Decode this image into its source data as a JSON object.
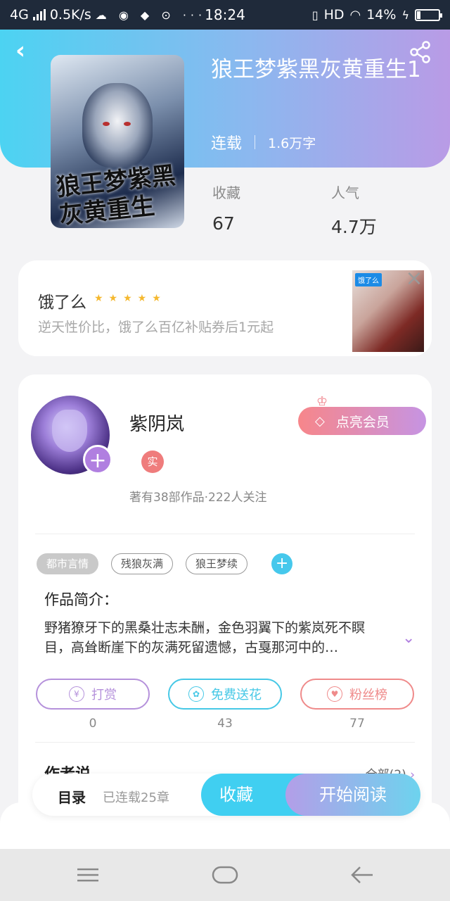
{
  "status_bar": {
    "network": "4G",
    "speed": "0.5K/s",
    "time": "18:24",
    "hd": "HD",
    "battery": "14%"
  },
  "book": {
    "title": "狼王梦紫黑灰黄重生1",
    "status": "连载",
    "word_count": "1.6万字",
    "cover_text": "狼王梦紫黑灰黄重生",
    "favorites_label": "收藏",
    "favorites_value": "67",
    "popularity_label": "人气",
    "popularity_value": "4.7万"
  },
  "ad": {
    "name": "饿了么",
    "rating": 5,
    "description": "逆天性价比，饿了么百亿补贴券后1元起",
    "thumb_logo": "饿了么"
  },
  "author": {
    "name": "紫阴岚",
    "badge": "实",
    "stats": "著有38部作品·222人关注",
    "vip_button": "点亮会员"
  },
  "tags": [
    "都市言情",
    "残狼灰满",
    "狼王梦续"
  ],
  "intro": {
    "title": "作品简介：",
    "text": "野猪獠牙下的黑桑壮志未酬，金色羽翼下的紫岚死不瞑目，高耸断崖下的灰满死留遗憾，古戛那河中的…"
  },
  "actions": [
    {
      "label": "打赏",
      "count": "0",
      "color": "#b591db"
    },
    {
      "label": "免费送花",
      "count": "43",
      "color": "#46c8e6"
    },
    {
      "label": "粉丝榜",
      "count": "77",
      "color": "#ef8a8a"
    }
  ],
  "author_says": {
    "title": "作者说",
    "all_link": "全部(2)"
  },
  "bottom_bar": {
    "toc": "目录",
    "chapters": "已连载25章",
    "favorite": "收藏",
    "read": "开始阅读"
  },
  "colors": {
    "hero_start": "#4cd3f2",
    "hero_end": "#b99be6",
    "accent_cyan": "#40cff1",
    "accent_purple": "#b07fe0"
  }
}
